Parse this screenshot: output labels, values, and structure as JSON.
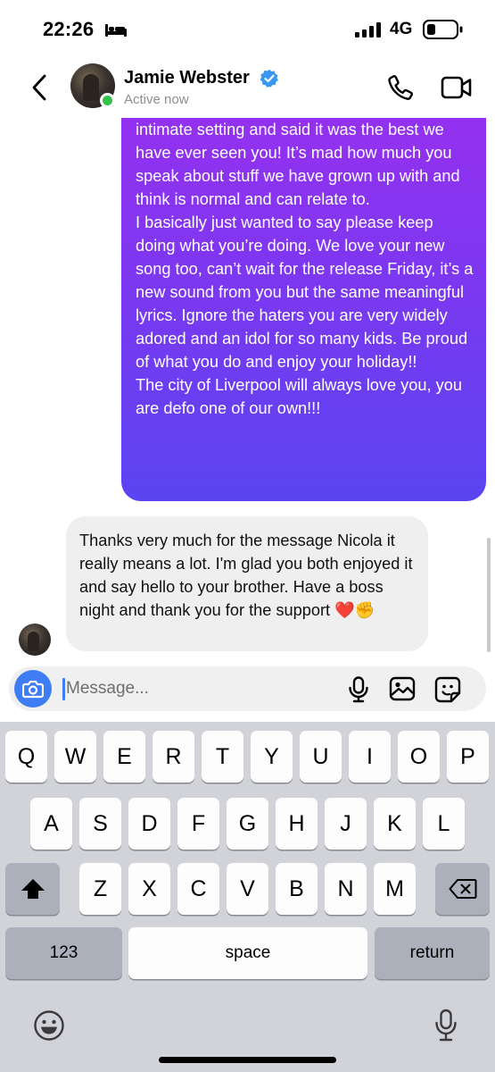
{
  "status_bar": {
    "time": "22:26",
    "network": "4G",
    "icons": [
      "bed-icon",
      "signal-bars-icon",
      "battery-icon"
    ]
  },
  "header": {
    "name": "Jamie Webster",
    "status": "Active now",
    "verified": true,
    "icons": [
      "back-chevron-icon",
      "phone-icon",
      "video-camera-icon",
      "verified-badge-icon"
    ]
  },
  "messages": {
    "sent": {
      "paragraphs": [
        "intimate setting and said it was the best we have ever seen you! It’s mad how much you speak about stuff we have grown up with and think is normal and can relate to.",
        "I basically just wanted to say please keep doing what you’re doing. We love your new song too, can’t wait for the release Friday, it’s a new sound from you but the same meaningful lyrics. Ignore the haters you are very widely adored and an idol for so many kids. Be proud of what you do and enjoy your holiday!!",
        "The city of Liverpool will always love you, you are defo one of our own!!!"
      ]
    },
    "received": {
      "text": "Thanks very much for the message Nicola it really means a lot. I'm glad you both enjoyed it and say hello to your brother. Have a boss night and thank you for the support",
      "emoji": "❤️✊"
    }
  },
  "composer": {
    "placeholder": "Message...",
    "icons": [
      "camera-icon",
      "microphone-icon",
      "gallery-icon",
      "sticker-icon"
    ]
  },
  "keyboard": {
    "row1": [
      "Q",
      "W",
      "E",
      "R",
      "T",
      "Y",
      "U",
      "I",
      "O",
      "P"
    ],
    "row2": [
      "A",
      "S",
      "D",
      "F",
      "G",
      "H",
      "J",
      "K",
      "L"
    ],
    "row3": [
      "Z",
      "X",
      "C",
      "V",
      "B",
      "N",
      "M"
    ],
    "numbers_key": "123",
    "space_key": "space",
    "return_key": "return",
    "icons": [
      "shift-icon",
      "backspace-icon",
      "emoji-icon",
      "dictation-mic-icon"
    ]
  },
  "colors": {
    "bubble_sent_top": "#9a2ff0",
    "bubble_sent_bottom": "#5a44f2",
    "bubble_received": "#efefef",
    "accent": "#3f7df5",
    "active_dot": "#31c24a",
    "keyboard_bg": "#d1d3d9"
  }
}
